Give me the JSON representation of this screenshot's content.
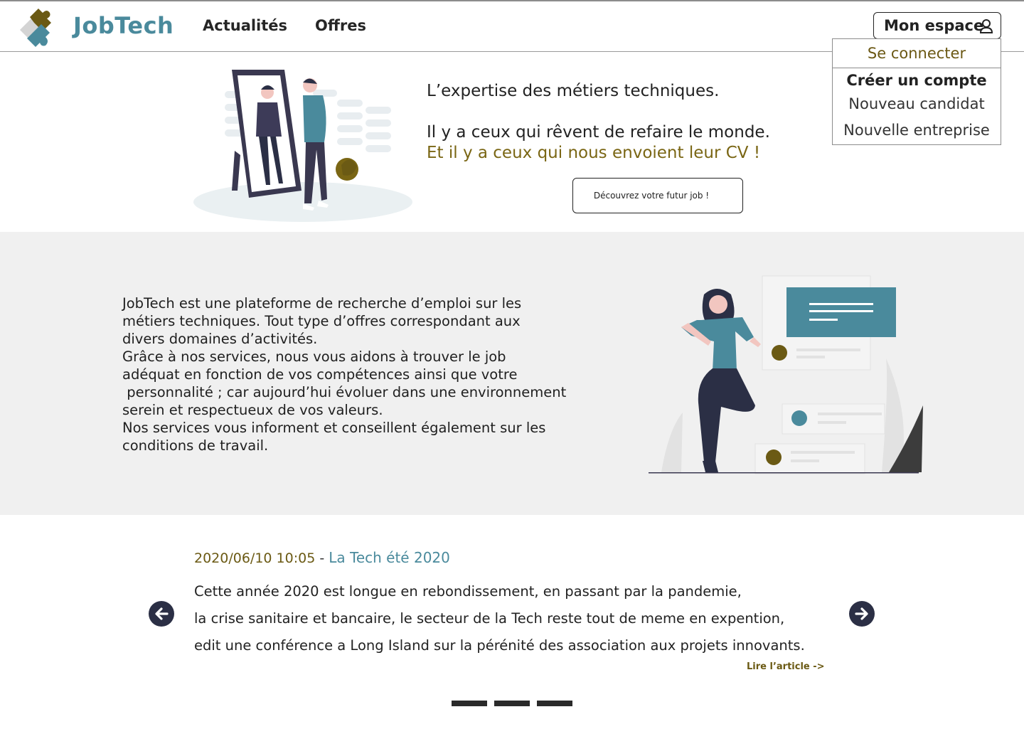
{
  "header": {
    "brand": "JobTech",
    "nav": [
      "Actualités",
      "Offres"
    ],
    "account_label": "Mon espace"
  },
  "dropdown": {
    "login": "Se connecter",
    "create_heading": "Créer un compte",
    "new_candidate": "Nouveau candidat",
    "new_company": "Nouvelle entreprise"
  },
  "hero": {
    "line1": "L’expertise des métiers techniques.",
    "line2": "Il y a ceux qui rêvent de refaire le monde.",
    "line3": "Et il y a ceux qui nous envoient leur CV !",
    "cta": "Découvrez votre futur job !"
  },
  "about": {
    "lines": [
      "JobTech est une plateforme de recherche d’emploi sur les",
      "métiers techniques. Tout type d’offres correspondant aux",
      "divers domaines d’activités.",
      "Grâce à nos services, nous vous aidons à trouver le job",
      "adéquat en fonction de vos compétences ainsi que votre",
      " personnalité ; car aujourd’hui évoluer dans une environnement",
      "serein et respectueux de vos valeurs.",
      "Nos services vous informent et conseillent également sur les",
      "conditions de travail."
    ]
  },
  "news": {
    "date": "2020/06/10 10:05",
    "separator": " - ",
    "title": "La Tech été 2020",
    "lines": [
      "Cette année 2020 est longue en rebondissement, en passant par la pandemie,",
      "la crise sanitaire et bancaire, le secteur de la Tech reste tout de meme en expention,",
      "edit une conférence a Long Island sur la pérénité des association aux projets innovants."
    ],
    "read_more": "Lire l’article ->",
    "slides_count": 3
  },
  "colors": {
    "brand_teal": "#4a8a9c",
    "accent_olive": "#7a6614",
    "dark_navy": "#2b2f45",
    "band_gray": "#f0f0f0"
  },
  "icons": [
    "puzzle-logo-icon",
    "user-icon",
    "arrow-left-icon",
    "arrow-right-icon"
  ]
}
